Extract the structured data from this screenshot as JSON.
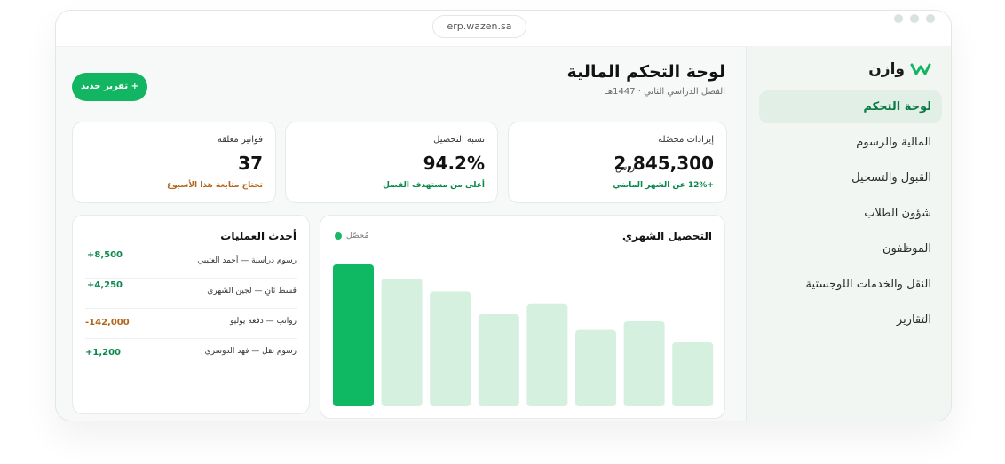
{
  "browser": {
    "url": "erp.wazen.sa"
  },
  "brand": {
    "name": "وازن",
    "accent": "#11b562"
  },
  "sidebar": {
    "items": [
      {
        "label": "لوحة التحكم",
        "active": true
      },
      {
        "label": "المالية والرسوم",
        "active": false
      },
      {
        "label": "القبول والتسجيل",
        "active": false
      },
      {
        "label": "شؤون الطلاب",
        "active": false
      },
      {
        "label": "الموظفون",
        "active": false
      },
      {
        "label": "النقل والخدمات اللوجستية",
        "active": false
      },
      {
        "label": "التقارير",
        "active": false
      }
    ]
  },
  "header": {
    "title": "لوحة التحكم المالية",
    "subtitle": "الفصل الدراسي الثاني · 1447هـ",
    "new_report": "+ تقرير جديد"
  },
  "kpis": [
    {
      "label": "إيرادات محصّلة",
      "value": "2,845,300",
      "currency": "ر.س",
      "note": "+12% عن الشهر الماضي",
      "note_color": "#0a8a4c"
    },
    {
      "label": "نسبة التحصيل",
      "value": "94.2%",
      "note": "أعلى من مستهدف الفصل",
      "note_color": "#0a8a4c"
    },
    {
      "label": "فواتير معلقة",
      "value": "37",
      "note": "تحتاج متابعة هذا الأسبوع",
      "note_color": "#b4661a"
    }
  ],
  "chart": {
    "title": "التحصيل الشهري",
    "legend": "مُحصّل"
  },
  "chart_data": {
    "type": "bar",
    "categories": [
      "",
      "",
      "",
      "",
      "",
      "",
      "",
      ""
    ],
    "values": [
      100,
      90,
      81,
      65,
      72,
      54,
      60,
      45
    ],
    "highlight_index": 0,
    "ylim": [
      0,
      100
    ],
    "colors": {
      "highlight": "#0fb862",
      "normal": "#d6f0e0"
    }
  },
  "operations": {
    "title": "أحدث العمليات",
    "rows": [
      {
        "desc": "رسوم دراسية — أحمد العتيبي",
        "amount": "+8,500",
        "color": "#0a8a4c"
      },
      {
        "desc": "قسط ثانٍ — لجين الشهري",
        "amount": "+4,250",
        "color": "#0a8a4c"
      },
      {
        "desc": "رواتب — دفعة يوليو",
        "amount": "-142,000",
        "color": "#b4661a"
      },
      {
        "desc": "رسوم نقل — فهد الدوسري",
        "amount": "+1,200",
        "color": "#0a8a4c"
      }
    ]
  }
}
